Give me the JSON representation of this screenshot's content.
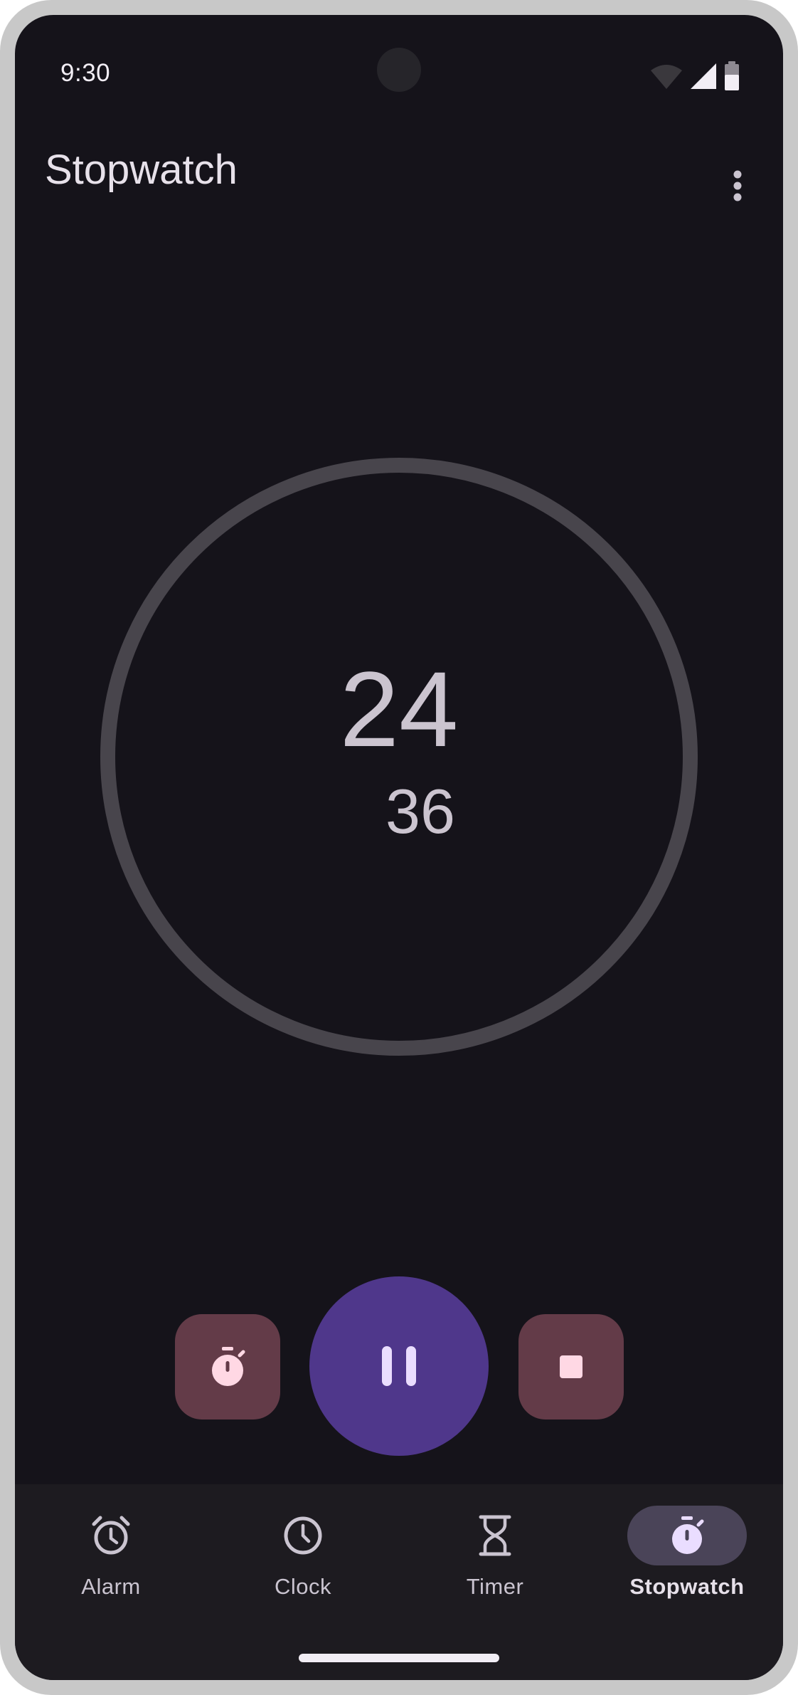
{
  "status_bar": {
    "time": "9:30",
    "icons": [
      "wifi-icon",
      "cellular-signal-icon",
      "battery-icon"
    ]
  },
  "app_bar": {
    "title": "Stopwatch",
    "overflow_icon": "more-vert-icon"
  },
  "stopwatch": {
    "seconds": "24",
    "hundredths": "36"
  },
  "controls": {
    "lap_icon": "timer-icon",
    "pause_icon": "pause-icon",
    "stop_icon": "stop-icon"
  },
  "bottom_nav": {
    "items": [
      {
        "label": "Alarm",
        "icon": "alarm-icon",
        "active": false
      },
      {
        "label": "Clock",
        "icon": "clock-icon",
        "active": false
      },
      {
        "label": "Timer",
        "icon": "hourglass-icon",
        "active": false
      },
      {
        "label": "Stopwatch",
        "icon": "timer-icon",
        "active": true
      }
    ]
  },
  "colors": {
    "background": "#15131a",
    "dial_ring": "#48454c",
    "primary_button": "#4f378b",
    "secondary_button": "#633b48",
    "nav_background": "#1d1b20",
    "nav_indicator": "#4a4458",
    "on_surface": "#e6e0e9"
  }
}
